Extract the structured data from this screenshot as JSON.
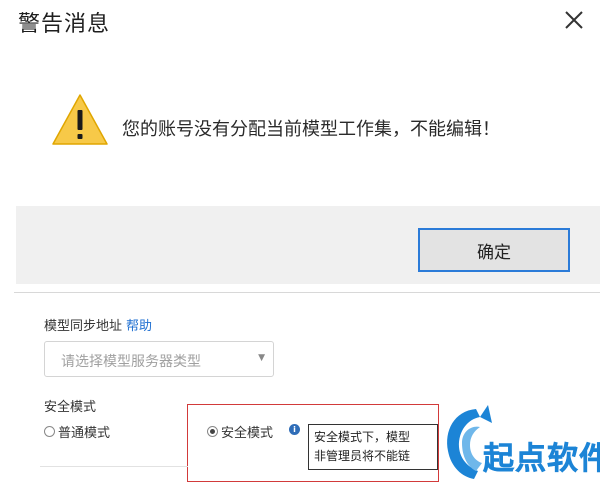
{
  "dialog": {
    "title": "警告消息",
    "message": "您的账号没有分配当前模型工作集，不能编辑！",
    "ok_label": "确定",
    "icons": {
      "close": "close-icon",
      "warning": "warning-triangle-icon"
    }
  },
  "settings": {
    "sync_label": "模型同步地址",
    "help_label": "帮助",
    "server_select_placeholder": "请选择模型服务器类型",
    "safe_mode_label": "安全模式",
    "options": [
      {
        "label": "普通模式",
        "checked": false
      },
      {
        "label": "安全模式",
        "checked": true
      }
    ],
    "tooltip_lines": [
      "安全模式下，模型",
      "非管理员将不能链"
    ]
  },
  "watermark": {
    "text": "起点软件"
  },
  "colors": {
    "accent": "#2b7bd8",
    "highlight_border": "#d23a3a",
    "link": "#1f6fd1",
    "watermark": "#1c84d6",
    "warning": "#f7c948"
  }
}
